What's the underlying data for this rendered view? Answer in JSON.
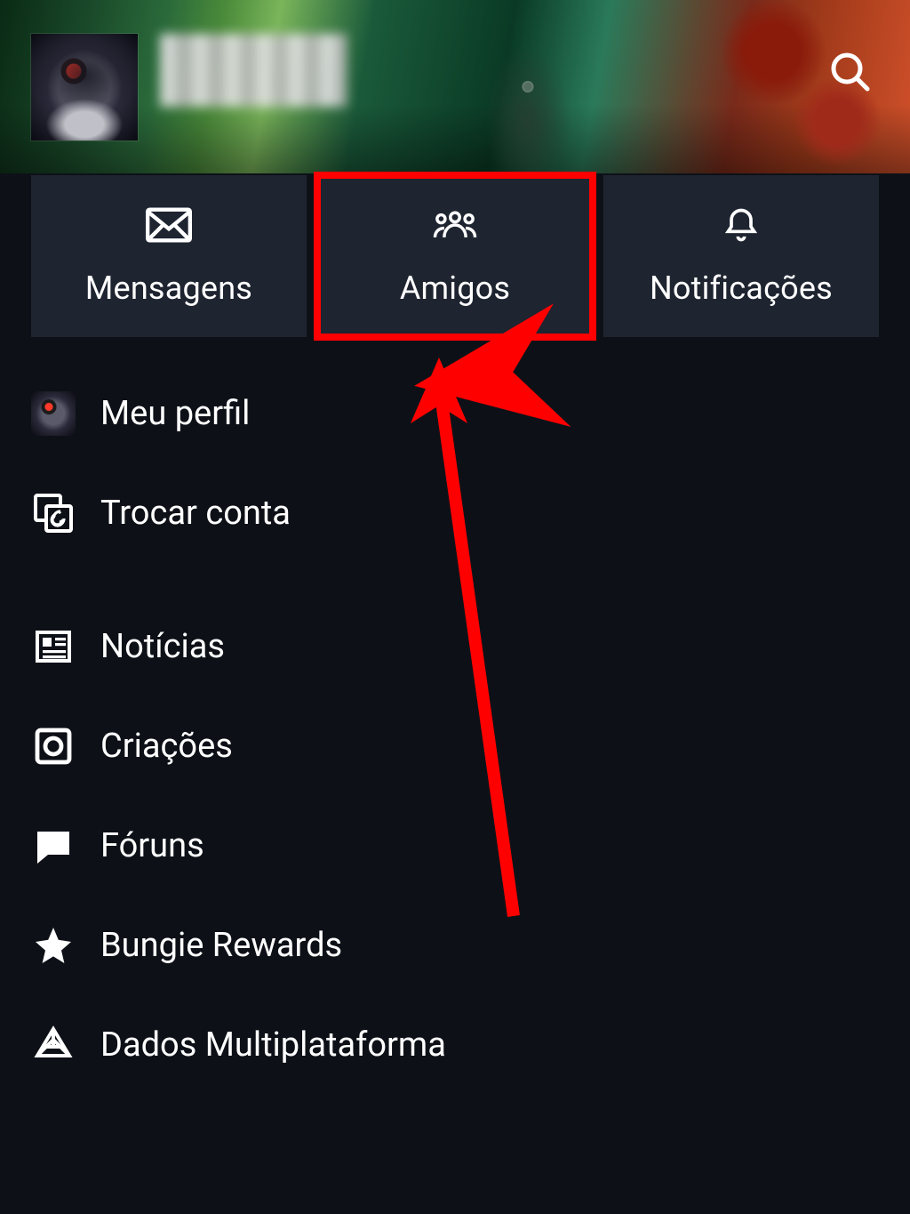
{
  "header": {
    "username": "[obscured]"
  },
  "tiles": {
    "messages": {
      "label": "Mensagens"
    },
    "friends": {
      "label": "Amigos"
    },
    "notifications": {
      "label": "Notificações"
    }
  },
  "menu": {
    "profile": {
      "label": "Meu perfil"
    },
    "switch": {
      "label": "Trocar conta"
    },
    "news": {
      "label": "Notícias"
    },
    "creations": {
      "label": "Criações"
    },
    "forums": {
      "label": "Fóruns"
    },
    "rewards": {
      "label": "Bungie Rewards"
    },
    "crossplay": {
      "label": "Dados Multiplataforma"
    }
  },
  "annotation": {
    "highlight_target": "friends"
  }
}
